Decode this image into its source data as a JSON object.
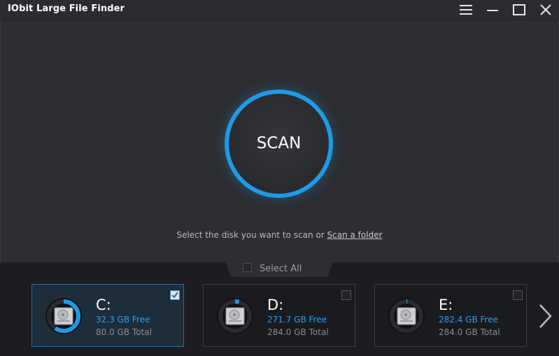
{
  "window": {
    "title": "IObit Large File Finder",
    "controls": [
      "menu-icon",
      "minimize-icon",
      "maximize-icon",
      "close-icon"
    ]
  },
  "scan": {
    "button_label": "SCAN",
    "hint_text": "Select the disk you want to scan or ",
    "hint_link": "Scan a folder"
  },
  "select_all": {
    "label": "Select All",
    "checked": false
  },
  "disks": [
    {
      "letter": "C:",
      "free": "32.3 GB Free",
      "total": "80.0 GB Total",
      "used_fraction": 0.596,
      "selected": true
    },
    {
      "letter": "D:",
      "free": "271.7 GB Free",
      "total": "284.0 GB Total",
      "used_fraction": 0.043,
      "selected": false
    },
    {
      "letter": "E:",
      "free": "282.4 GB Free",
      "total": "284.0 GB Total",
      "used_fraction": 0.006,
      "selected": false
    }
  ],
  "colors": {
    "accent": "#1e9be8",
    "free_text": "#2a9ef0",
    "background": "#2d2e32",
    "panel": "#1c1d20"
  }
}
